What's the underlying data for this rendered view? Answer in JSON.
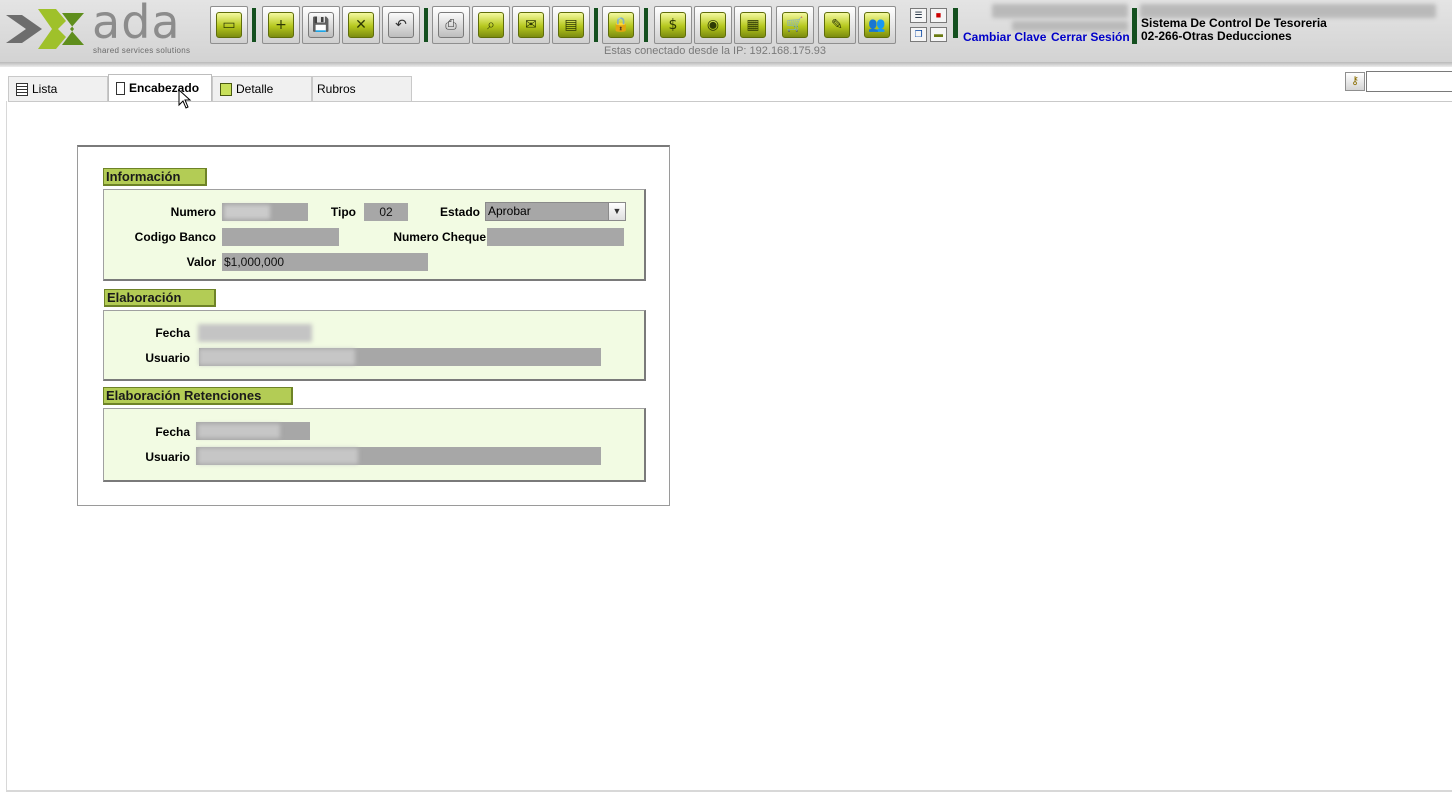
{
  "header": {
    "logo_word": "ada",
    "logo_tagline": "shared services solutions",
    "ip_text": "Estas conectado desde la IP: 192.168.175.93",
    "change_password": "Cambiar Clave",
    "logout": "Cerrar Sesión",
    "system_title": "Sistema De Control De Tesoreria",
    "module_title": "02-266-Otras Deducciones"
  },
  "toolbar": {
    "icons": [
      "open-folder-icon",
      "new-document-icon",
      "save-icon",
      "delete-icon",
      "undo-icon",
      "print-icon",
      "search-icon",
      "export-excel-icon",
      "money-basket-icon",
      "lock-icon",
      "money-bag-icon",
      "camera-icon",
      "grid-icon",
      "cart-icon",
      "approve-icon",
      "users-icon"
    ],
    "glyphs": [
      "▭",
      "+",
      "💾",
      "✕",
      "↶",
      "⎙",
      "⌕",
      "✉",
      "▤",
      "🔒",
      "$",
      "◉",
      "▦",
      "🛒",
      "✎",
      "👥"
    ]
  },
  "tabs": [
    {
      "label": "Lista",
      "icon": "list-icon"
    },
    {
      "label": "Encabezado",
      "icon": "header-icon",
      "active": true
    },
    {
      "label": "Detalle",
      "icon": "detail-icon"
    },
    {
      "label": "Rubros",
      "icon": ""
    }
  ],
  "informacion": {
    "title": "Información",
    "numero_label": "Numero",
    "tipo_label": "Tipo",
    "tipo_value": "02",
    "estado_label": "Estado",
    "estado_value": "Aprobar",
    "codigo_banco_label": "Codigo Banco",
    "numero_cheque_label": "Numero Cheque",
    "valor_label": "Valor",
    "valor_value": "$1,000,000"
  },
  "elaboracion": {
    "title": "Elaboración",
    "fecha_label": "Fecha",
    "usuario_label": "Usuario"
  },
  "elaboracion_retenciones": {
    "title": "Elaboración Retenciones",
    "fecha_label": "Fecha",
    "usuario_label": "Usuario"
  },
  "colors": {
    "accent_green": "#b3cc55",
    "panel_bg": "#f2fbe3",
    "link_blue": "#0000c8",
    "dark_green": "#14501f"
  }
}
